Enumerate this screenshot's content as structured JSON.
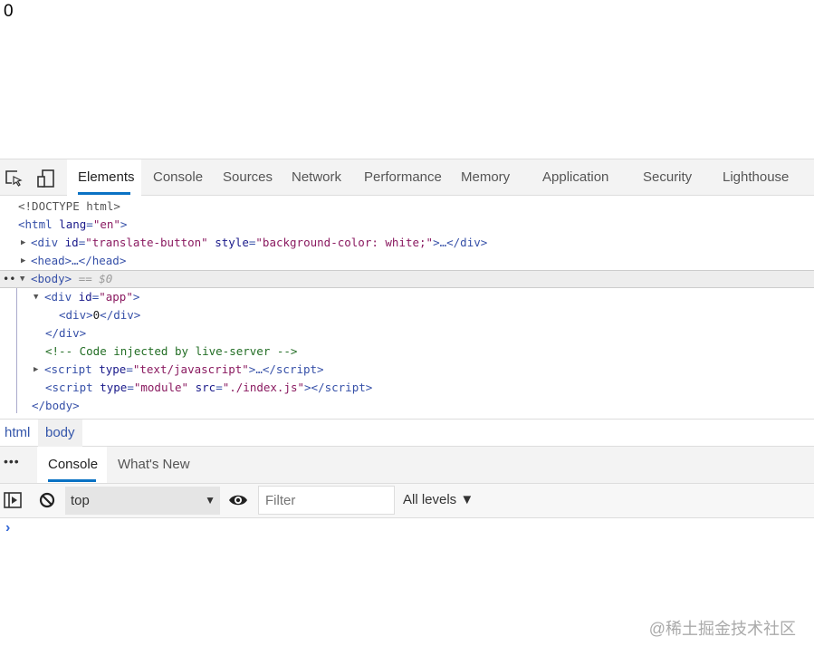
{
  "page": {
    "content": "0"
  },
  "devtools": {
    "tabs": [
      "Elements",
      "Console",
      "Sources",
      "Network",
      "Performance",
      "Memory",
      "Application",
      "Security",
      "Lighthouse"
    ],
    "dom": {
      "doctype": "<!DOCTYPE html>",
      "html_open": "<html",
      "lang_attr": "lang",
      "lang_val": "\"en\"",
      "div_translate": "<div",
      "id_attr": "id",
      "translate_id": "\"translate-button\"",
      "style_attr": "style",
      "style_val": "\"background-color: white;\"",
      "div_close_collapsed": ">…</div>",
      "head": "<head>…</head>",
      "body_open": "<body>",
      "body_marker": "== $0",
      "div_app": "<div",
      "app_id": "\"app\"",
      "inner_div": "<div>",
      "inner_text": "0",
      "inner_close": "</div>",
      "div_close": "</div>",
      "comment": "<!-- Code injected by live-server -->",
      "script1": "<script",
      "type_attr": "type",
      "script1_type": "\"text/javascript\"",
      "script1_close": ">…</script>",
      "script2": "<script",
      "script2_type": "\"module\"",
      "src_attr": "src",
      "script2_src": "\"./index.js\"",
      "script2_close": "></script>",
      "body_close": "</body>"
    },
    "breadcrumbs": [
      "html",
      "body"
    ],
    "drawer_tabs": [
      "Console",
      "What's New"
    ],
    "console": {
      "context": "top",
      "filter_placeholder": "Filter",
      "levels": "All levels ▼",
      "prompt": "›"
    }
  },
  "watermark": "@稀土掘金技术社区"
}
